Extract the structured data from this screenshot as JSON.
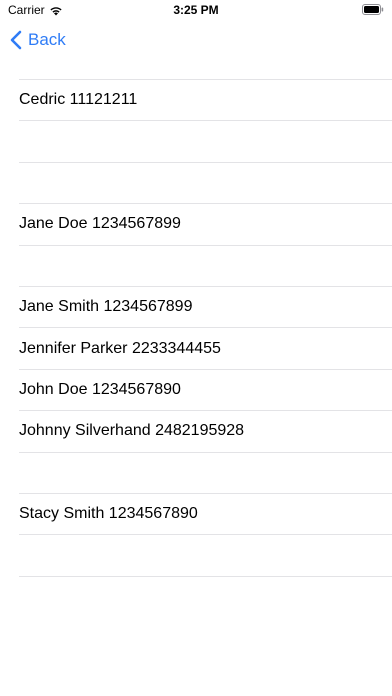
{
  "status_bar": {
    "carrier": "Carrier",
    "time": "3:25 PM",
    "icons": [
      "wifi-icon",
      "battery-icon"
    ]
  },
  "nav": {
    "back_label": "Back",
    "back_icon": "chevron-left-icon",
    "accent_color": "#2f7cf6"
  },
  "contacts": [
    {
      "label": "Cedric 11121211"
    },
    {
      "label": ""
    },
    {
      "label": ""
    },
    {
      "label": "Jane Doe 1234567899"
    },
    {
      "label": ""
    },
    {
      "label": "Jane Smith 1234567899"
    },
    {
      "label": "Jennifer Parker 2233344455"
    },
    {
      "label": "John Doe 1234567890"
    },
    {
      "label": "Johnny Silverhand 2482195928"
    },
    {
      "label": ""
    },
    {
      "label": "Stacy Smith 1234567890"
    },
    {
      "label": ""
    }
  ]
}
